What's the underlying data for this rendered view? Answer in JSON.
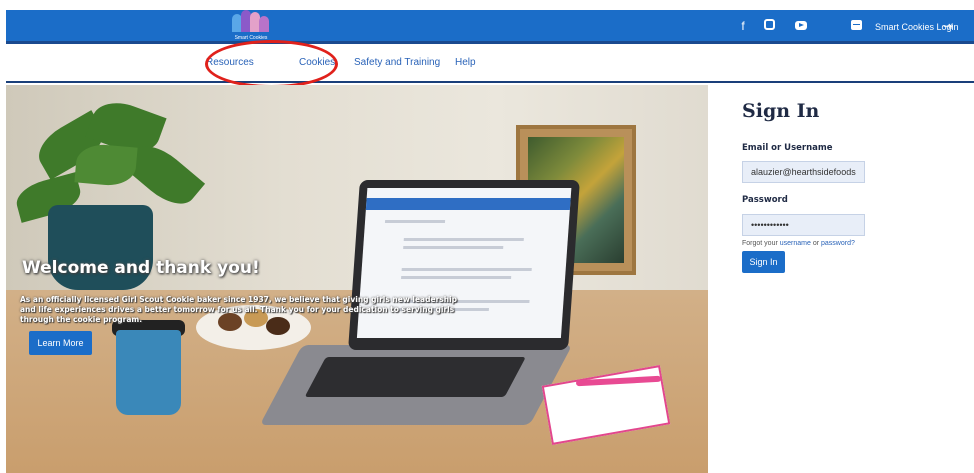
{
  "caption": "",
  "header": {
    "logo_text": "Smart Cookies",
    "login_label": "Smart Cookies Login",
    "social": [
      "facebook-icon",
      "instagram-icon",
      "youtube-icon",
      "chat-icon"
    ]
  },
  "nav": {
    "items": [
      "Resources",
      "Cookies",
      "Safety and Training",
      "Help"
    ]
  },
  "hero": {
    "title": "Welcome and thank you!",
    "body": "As an officially licensed Girl Scout Cookie baker since 1937, we believe that giving girls new leadership and life experiences drives a better tomorrow for us all. Thank you for your dedication to serving girls through the cookie program.",
    "button_label": "Learn More"
  },
  "signin": {
    "title": "Sign In",
    "email_label": "Email or Username",
    "email_value": "alauzier@hearthsidefoods",
    "password_label": "Password",
    "password_value": "••••••••••••",
    "forgot_prefix": "Forgot your ",
    "forgot_username": "username",
    "forgot_or": " or ",
    "forgot_password": "password?",
    "button_label": "Sign In"
  },
  "colors": {
    "brand_blue": "#1b6dc8",
    "nav_link": "#2a63b8",
    "highlight": "#e0211b"
  }
}
